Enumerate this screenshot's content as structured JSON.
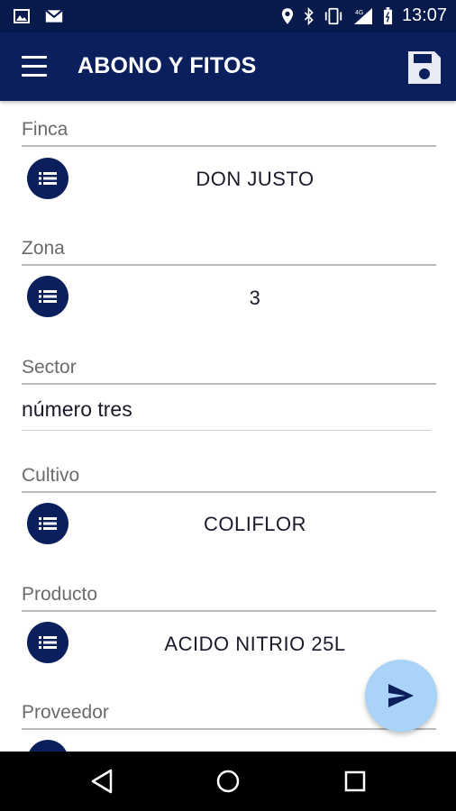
{
  "status_bar": {
    "time": "13:07",
    "icons": [
      "image-icon",
      "gmail-icon",
      "location-icon",
      "bluetooth-icon",
      "vibrate-icon",
      "signal-4g-icon",
      "battery-icon"
    ],
    "network": "4G"
  },
  "app_bar": {
    "title": "ABONO Y FITOS",
    "menu_icon": "hamburger-menu-icon",
    "save_icon": "floppy-disk-icon"
  },
  "form": {
    "finca": {
      "label": "Finca",
      "value": "DON JUSTO"
    },
    "zona": {
      "label": "Zona",
      "value": "3"
    },
    "sector": {
      "label": "Sector",
      "value": "número tres"
    },
    "cultivo": {
      "label": "Cultivo",
      "value": "COLIFLOR"
    },
    "producto": {
      "label": "Producto",
      "value": "ACIDO NITRIO 25L"
    },
    "proveedor": {
      "label": "Proveedor",
      "value": ""
    }
  },
  "fab": {
    "icon": "send-icon"
  },
  "nav_bar": {
    "icons": [
      "back-triangle-icon",
      "home-circle-icon",
      "recents-square-icon"
    ]
  },
  "colors": {
    "primary": "#0b1f5c",
    "status_bar": "#081a4c",
    "fab": "#a9d3f7"
  }
}
